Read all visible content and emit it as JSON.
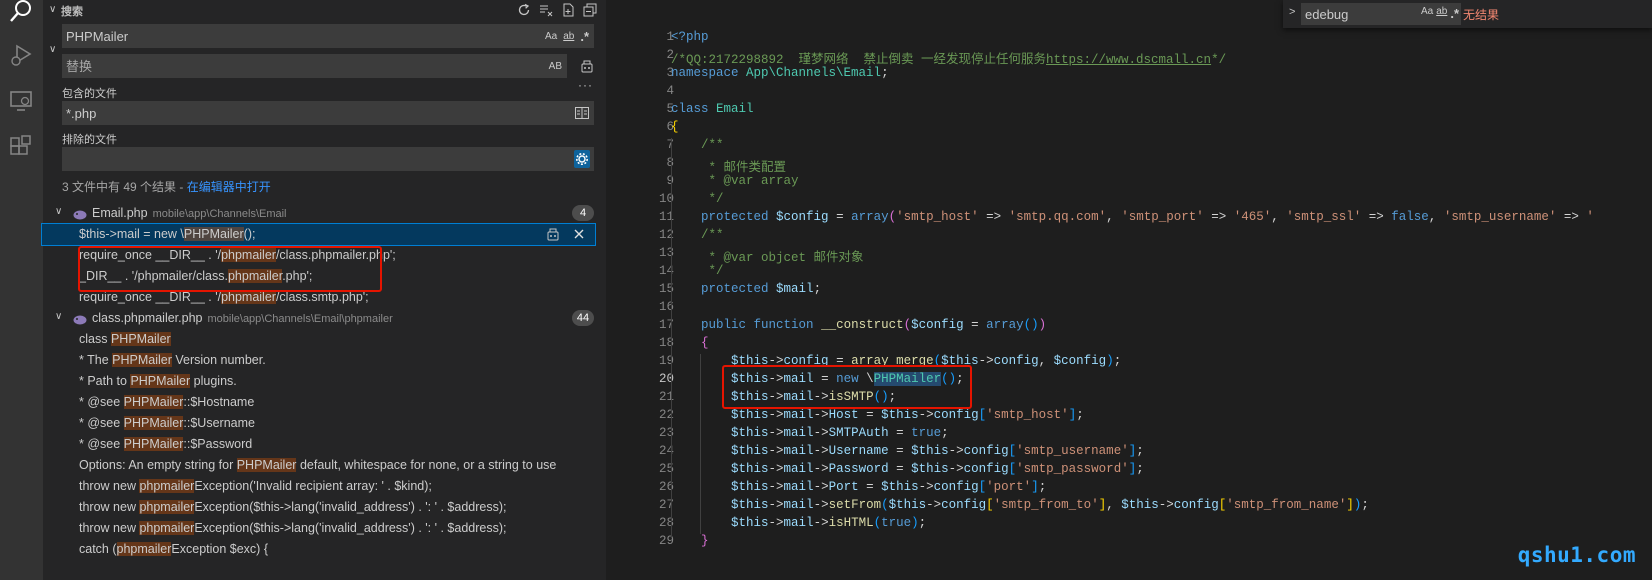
{
  "sidebar": {
    "title": "搜索",
    "search": {
      "value": "PHPMailer",
      "opt_case": "Aa",
      "opt_word": "ab",
      "opt_regex": ".*"
    },
    "replace": {
      "placeholder": "替换",
      "opt_preserve": "AB"
    },
    "include": {
      "label": "包含的文件",
      "value": "*.php"
    },
    "exclude": {
      "label": "排除的文件",
      "value": ""
    },
    "summary": {
      "text": "3 文件中有 49 个结果 - ",
      "link": "在编辑器中打开"
    },
    "files": [
      {
        "name": "Email.php",
        "path": "mobile\\app\\Channels\\Email",
        "count": "4",
        "matches": [
          {
            "pre": "$this->mail = new \\",
            "hit": "PHPMailer",
            "post": "();"
          },
          {
            "pre": "require_once __DIR__ . '/",
            "hit": "phpmailer",
            "post": "/class.phpmailer.php';"
          },
          {
            "pre": "_DIR__ . '/phpmailer/class.",
            "hit": "phpmailer",
            "post": ".php';"
          },
          {
            "pre": "require_once __DIR__ . '/",
            "hit": "phpmailer",
            "post": "/class.smtp.php';"
          }
        ]
      },
      {
        "name": "class.phpmailer.php",
        "path": "mobile\\app\\Channels\\Email\\phpmailer",
        "count": "44",
        "matches": [
          {
            "pre": "class ",
            "hit": "PHPMailer",
            "post": ""
          },
          {
            "pre": "* The ",
            "hit": "PHPMailer",
            "post": " Version number."
          },
          {
            "pre": "* Path to ",
            "hit": "PHPMailer",
            "post": " plugins."
          },
          {
            "pre": "* @see ",
            "hit": "PHPMailer",
            "post": "::$Hostname"
          },
          {
            "pre": "* @see ",
            "hit": "PHPMailer",
            "post": "::$Username"
          },
          {
            "pre": "* @see ",
            "hit": "PHPMailer",
            "post": "::$Password"
          },
          {
            "pre": "Options: An empty string for ",
            "hit": "PHPMailer",
            "post": " default, whitespace for none, or a string to use"
          },
          {
            "pre": "throw new ",
            "hit": "phpmailer",
            "post": "Exception('Invalid recipient array: ' . $kind);"
          },
          {
            "pre": "throw new ",
            "hit": "phpmailer",
            "post": "Exception($this->lang('invalid_address') . ': ' . $address);"
          },
          {
            "pre": "throw new ",
            "hit": "phpmailer",
            "post": "Exception($this->lang('invalid_address') . ': ' . $address);"
          },
          {
            "pre": "catch (",
            "hit": "phpmailer",
            "post": "Exception $exc) {"
          }
        ]
      }
    ]
  },
  "find_widget": {
    "value": "edebug",
    "opt_case": "Aa",
    "opt_word": "ab",
    "opt_regex": ".*",
    "status": "无结果"
  },
  "editor": {
    "line_numbers": [
      "1",
      "2",
      "3",
      "4",
      "5",
      "6",
      "7",
      "8",
      "9",
      "10",
      "11",
      "12",
      "13",
      "14",
      "15",
      "16",
      "17",
      "18",
      "19",
      "20",
      "21",
      "22",
      "23",
      "24",
      "25",
      "26",
      "27",
      "28",
      "29"
    ],
    "current_line": "20"
  },
  "watermark": "qshu1.com"
}
